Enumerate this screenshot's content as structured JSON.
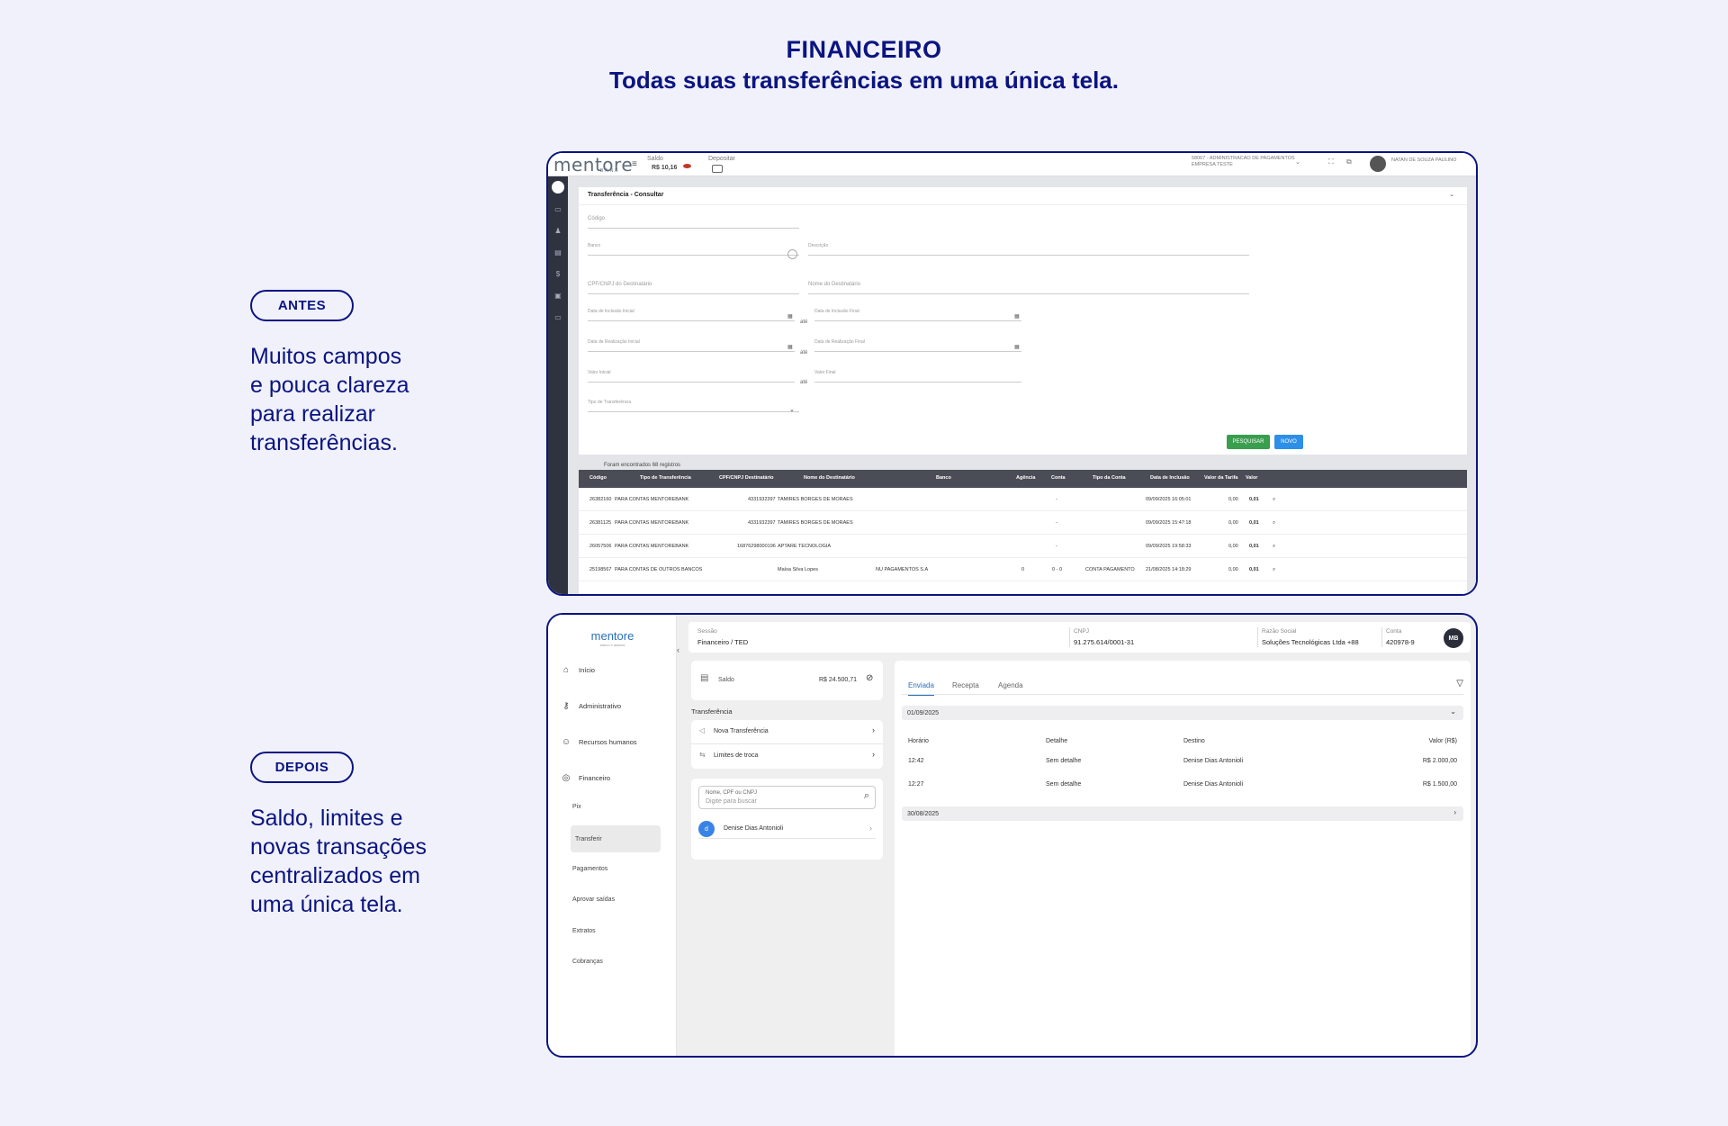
{
  "hero": {
    "title": "FINANCEIRO",
    "subtitle": "Todas suas transferências em uma única tela."
  },
  "antes": {
    "label": "ANTES",
    "caption_lines": [
      "Muitos campos",
      "e pouca clareza",
      "para realizar",
      "transferências."
    ]
  },
  "depois": {
    "label": "DEPOIS",
    "caption_lines": [
      "Saldo, limites e",
      "novas transações",
      "centralizados em",
      "uma única tela."
    ]
  },
  "before_app": {
    "logo": "mentore",
    "logo_sub": "BANK",
    "saldo_label": "Saldo",
    "saldo_value": "R$ 10,16",
    "depositar_label": "Depositar",
    "company_line1": "58067 - ADMINISTRACAO DE PAGAMENTOS",
    "company_line2": "EMPRESA TESTE",
    "user_name": "NATAN DE SOUZA PAULINO",
    "panel_title": "Transferência - Consultar",
    "fields": {
      "codigo": "Código",
      "banco": "Banco",
      "descricao": "Descrição",
      "cpf": "CPF/CNPJ do Destinatário",
      "nome": "Nome do Destinatário",
      "inclusao_ini": "Data de Inclusão Inicial",
      "inclusao_fim": "Data de Inclusão Final",
      "realizacao_ini": "Data de Realização Inicial",
      "realizacao_fim": "Data de Realização Final",
      "valor_ini": "Valor Inicial",
      "valor_fim": "Valor Final",
      "tipo": "Tipo de Transferência",
      "ate": "até"
    },
    "btn_pesquisar": "PESQUISAR",
    "btn_novo": "NOVO",
    "count_text": "Foram encontrados 68 registros",
    "columns": [
      "Código",
      "Tipo de Transferência",
      "CPF/CNPJ Destinatário",
      "Nome do Destinatário",
      "Banco",
      "Agência",
      "Conta",
      "Tipo da Conta",
      "Data de Inclusão",
      "Valor da Tarifa",
      "Valor"
    ],
    "rows": [
      {
        "codigo": "26382160",
        "tipo": "PARA CONTAS MENTOREBANK",
        "cpf": "4331932397",
        "nome": "TAMIRES BORGES DE MORAES",
        "banco": "",
        "agencia": "",
        "conta": "-",
        "tipo_conta": "",
        "data": "09/09/2025 16:05:01",
        "tarifa": "0,00",
        "valor": "0,01"
      },
      {
        "codigo": "26381125",
        "tipo": "PARA CONTAS MENTOREBANK",
        "cpf": "4331932397",
        "nome": "TAMIRES BORGES DE MORAES",
        "banco": "",
        "agencia": "",
        "conta": "-",
        "tipo_conta": "",
        "data": "09/09/2025 15:47:18",
        "tarifa": "0,00",
        "valor": "0,01"
      },
      {
        "codigo": "26057506",
        "tipo": "PARA CONTAS MENTOREBANK",
        "cpf": "16876298000196",
        "nome": "APTARE TECNOLOGIA",
        "banco": "",
        "agencia": "",
        "conta": "-",
        "tipo_conta": "",
        "data": "09/09/2025 19:58:33",
        "tarifa": "0,00",
        "valor": "0,01"
      },
      {
        "codigo": "25198567",
        "tipo": "PARA CONTAS DE OUTROS BANCOS",
        "cpf": "",
        "nome": "Maísa Silva Lopes",
        "banco": "NU PAGAMENTOS S.A",
        "agencia": "0",
        "conta": "0 - 0",
        "tipo_conta": "CONTA PAGAMENTO",
        "data": "21/08/2025 14:18:29",
        "tarifa": "0,00",
        "valor": "0,01"
      }
    ]
  },
  "after_app": {
    "logo": "mentore",
    "logo_sub": "banco e assess",
    "nav": [
      "Início",
      "Administrativo",
      "Recursos humanos",
      "Financeiro"
    ],
    "subnav": [
      "Pix",
      "Transferir",
      "Pagamentos",
      "Aprovar saídas",
      "Extratos",
      "Cobranças"
    ],
    "header": {
      "sessao_label": "Sessão",
      "sessao_value": "Financeiro / TED",
      "cnpj_label": "CNPJ",
      "cnpj_value": "91.275.614/0001-31",
      "razao_label": "Razão Social",
      "razao_value": "Soluções Tecnológicas Ltda +88",
      "conta_label": "Conta",
      "conta_value": "420978-9",
      "avatar": "MB"
    },
    "saldo_label": "Saldo",
    "saldo_value": "R$ 24.500,71",
    "transferencia_title": "Transferência",
    "actions": [
      "Nova Transferência",
      "Limites de troca"
    ],
    "search_label": "Nome, CPF ou CNPJ",
    "search_placeholder": "Digite para buscar",
    "contact_name": "Denise Dias Antonioli",
    "contact_initial": "d",
    "tabs": [
      "Enviada",
      "Recepta",
      "Agenda"
    ],
    "groups": [
      {
        "date": "01/09/2025",
        "columns": [
          "Horário",
          "Detalhe",
          "Destino",
          "Valor (R$)"
        ],
        "rows": [
          {
            "hora": "12:42",
            "detalhe": "Sem detalhe",
            "destino": "Denise Dias Antonioli",
            "valor": "R$ 2.000,00"
          },
          {
            "hora": "12:27",
            "detalhe": "Sem detalhe",
            "destino": "Denise Dias Antonioli",
            "valor": "R$ 1.500,00"
          }
        ]
      },
      {
        "date": "30/08/2025"
      }
    ]
  }
}
